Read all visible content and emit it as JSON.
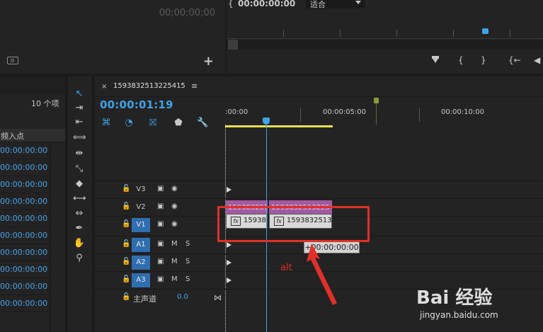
{
  "source_monitor": {
    "timecode": "00;00;00;00"
  },
  "program_monitor": {
    "timecode": "00:00:00:00",
    "timecode_prefix": "{",
    "fit_label": "适合",
    "transport": [
      "{",
      "}",
      "{←",
      "◀"
    ]
  },
  "project": {
    "item_count": "10 个项",
    "col_header": "频入点",
    "rows": [
      "00:00:00:00",
      "00:00:00:00",
      "00:00:00:00",
      "00:00:00:00",
      "00:00:00:00",
      "00:00:00:00",
      "00:00:00:00",
      "00:00:00:00",
      "00:00:00:00",
      "00:00:00:00"
    ]
  },
  "timeline": {
    "sequence_name": "1593832513225415",
    "close": "×",
    "menu": "≡",
    "timecode": "00:00:01:19",
    "ruler_labels": [
      ":00:00",
      "00:00:05:00",
      "00:00:10:00"
    ],
    "tracks": [
      {
        "name": "V3",
        "targeted": false,
        "i2": "◉",
        "i3": ""
      },
      {
        "name": "V2",
        "targeted": false,
        "i2": "◉",
        "i3": ""
      },
      {
        "name": "V1",
        "targeted": true,
        "i2": "◉",
        "i3": ""
      },
      {
        "name": "A1",
        "targeted": true,
        "i2": "M",
        "i3": "S"
      },
      {
        "name": "A2",
        "targeted": true,
        "i2": "M",
        "i3": "S"
      },
      {
        "name": "A3",
        "targeted": true,
        "i2": "M",
        "i3": "S"
      }
    ],
    "master_label": "主声道",
    "master_volume": "0.0",
    "clips_v2": [
      "1593832513",
      "1593832513225415"
    ],
    "clips_v1": [
      "15938",
      "1593832513"
    ],
    "fx_label": "fx",
    "tooltip": "+00:00:00:00"
  },
  "annotation": {
    "text": "alt"
  },
  "watermark": {
    "brand": "Bai 经验",
    "url": "jingyan.baidu.com"
  },
  "colors": {
    "accent": "#3fa3e6",
    "clip_v2": "#a25aa0",
    "annotation": "#e0302a",
    "inout_bar": "#e9e049"
  }
}
